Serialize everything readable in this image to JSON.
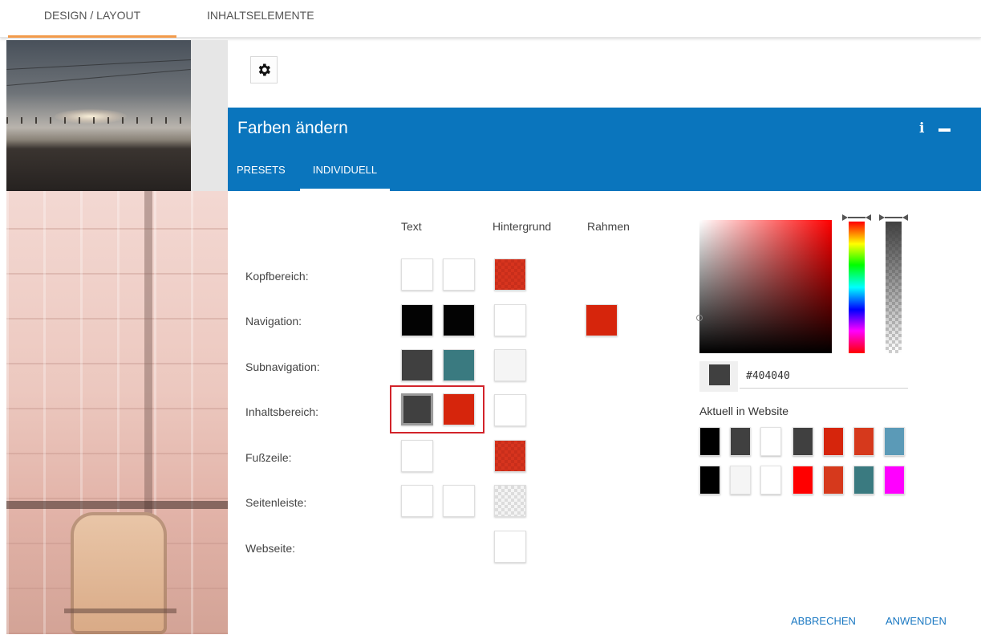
{
  "top_tabs": [
    {
      "label": "DESIGN / LAYOUT",
      "active": true
    },
    {
      "label": "INHALTSELEMENTE",
      "active": false
    }
  ],
  "dialog": {
    "title": "Farben ändern",
    "info_icon": "i",
    "tabs": [
      {
        "label": "PRESETS",
        "active": false
      },
      {
        "label": "INDIVIDUELL",
        "active": true
      }
    ],
    "columns": {
      "text": "Text",
      "background": "Hintergrund",
      "border": "Rahmen"
    },
    "rows": [
      {
        "label": "Kopfbereich:"
      },
      {
        "label": "Navigation:"
      },
      {
        "label": "Subnavigation:"
      },
      {
        "label": "Inhaltsbereich:"
      },
      {
        "label": "Fußzeile:"
      },
      {
        "label": "Seitenleiste:"
      },
      {
        "label": "Webseite:"
      }
    ],
    "swatch_colors": {
      "white": "#ffffff",
      "black": "#030303",
      "dark_grey": "#404040",
      "teal": "#3a7a80",
      "red": "#d6250c",
      "light_grey": "#f5f5f5"
    },
    "picker": {
      "hue_color": "#ff0000",
      "current_value": "#404040",
      "current_in_website_label": "Aktuell in Website",
      "website_colors": [
        "#000000",
        "#404040",
        "#ffffff",
        "#404040",
        "#d6250c",
        "#d6391c",
        "#5b9ab7",
        "#000000",
        "#f5f5f5",
        "#f0f0f0",
        "#ff0000",
        "#d6391c",
        "#3a7a80",
        "#ff00ff"
      ]
    },
    "buttons": {
      "cancel": "ABBRECHEN",
      "apply": "ANWENDEN"
    }
  }
}
